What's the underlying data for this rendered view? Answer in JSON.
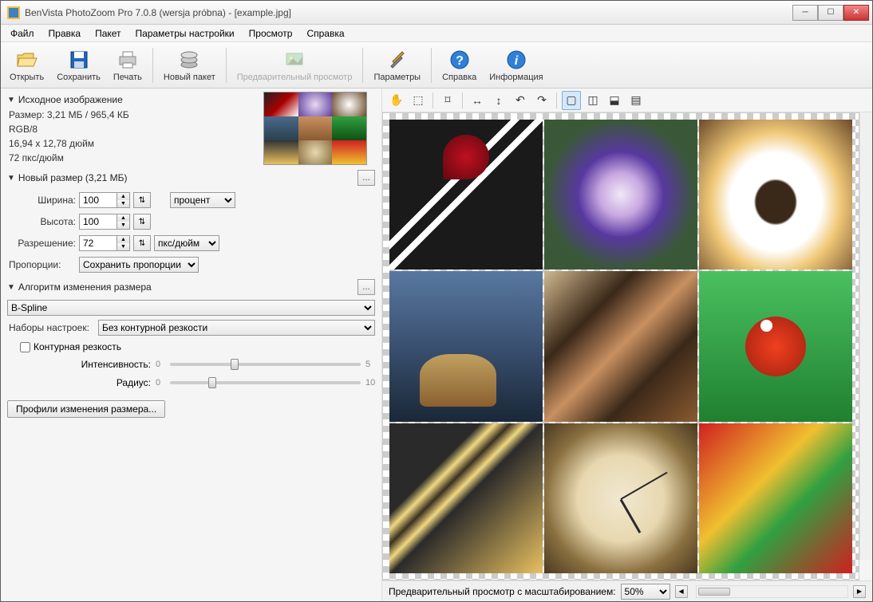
{
  "window": {
    "title": "BenVista PhotoZoom Pro 7.0.8 (wersja próbna) - [example.jpg]"
  },
  "menu": {
    "file": "Файл",
    "edit": "Правка",
    "packet": "Пакет",
    "params": "Параметры настройки",
    "view": "Просмотр",
    "help": "Справка"
  },
  "toolbar": {
    "open": "Открыть",
    "save": "Сохранить",
    "print": "Печать",
    "newbatch": "Новый пакет",
    "preview": "Предварительный просмотр",
    "params": "Параметры",
    "help": "Справка",
    "info": "Информация"
  },
  "source": {
    "header": "Исходное изображение",
    "size": "Размер: 3,21 МБ / 965,4 КБ",
    "mode": "RGB/8",
    "dims": "16,94 x 12,78 дюйм",
    "dpi": "72 пкс/дюйм"
  },
  "newsize": {
    "header": "Новый размер (3,21 МБ)",
    "width_label": "Ширина:",
    "height_label": "Высота:",
    "resolution_label": "Разрешение:",
    "width": "100",
    "height": "100",
    "resolution": "72",
    "unit_percent": "процент",
    "unit_dpi": "пкс/дюйм",
    "proportions_label": "Пропорции:",
    "proportions": "Сохранить пропорции"
  },
  "algo": {
    "header": "Алгоритм изменения размера",
    "method": "B-Spline",
    "presets_label": "Наборы настроек:",
    "preset": "Без контурной резкости",
    "unsharp_label": "Контурная резкость",
    "intensity_label": "Интенсивность:",
    "radius_label": "Радиус:",
    "intensity_min": "0",
    "intensity_max": "5",
    "radius_min": "0",
    "radius_max": "10",
    "profiles_btn": "Профили изменения размера..."
  },
  "preview": {
    "label": "Предварительный просмотр с масштабированием:",
    "zoom": "50%"
  }
}
